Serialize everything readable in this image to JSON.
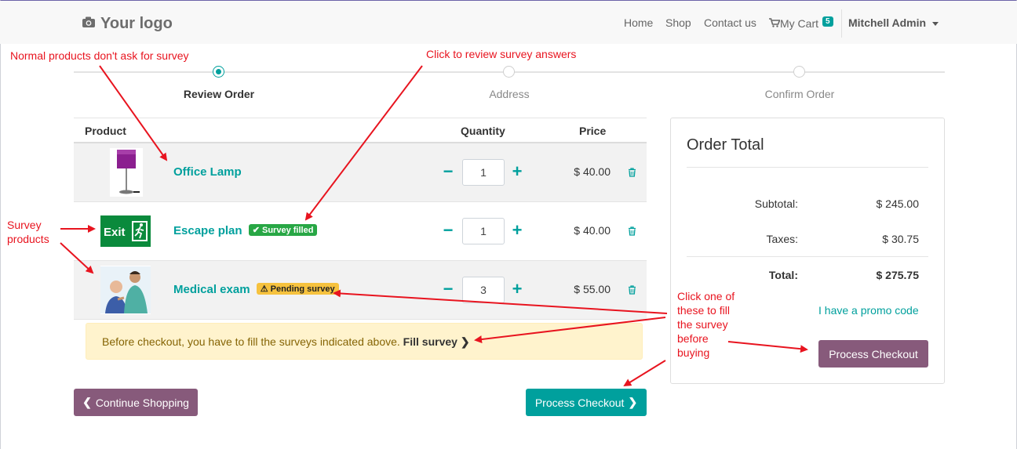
{
  "navbar": {
    "logo": "Your logo",
    "links": [
      "Home",
      "Shop",
      "Contact us"
    ],
    "cart_label": "My Cart",
    "cart_count": "5",
    "user": "Mitchell Admin"
  },
  "wizard": {
    "steps": [
      "Review Order",
      "Address",
      "Confirm Order"
    ],
    "active": 0
  },
  "table": {
    "headers": {
      "product": "Product",
      "quantity": "Quantity",
      "price": "Price"
    },
    "rows": [
      {
        "name": "Office Lamp",
        "badge": "",
        "qty": "1",
        "price": "$ 40.00"
      },
      {
        "name": "Escape plan",
        "badge": "Survey filled",
        "qty": "1",
        "price": "$ 40.00"
      },
      {
        "name": "Medical exam",
        "badge": "Pending survey",
        "qty": "3",
        "price": "$ 55.00"
      }
    ]
  },
  "alert": {
    "text": "Before checkout, you have to fill the surveys indicated above.",
    "link": "Fill survey"
  },
  "buttons": {
    "continue": "Continue Shopping",
    "checkout": "Process Checkout",
    "checkout_side": "Process Checkout"
  },
  "order_total": {
    "title": "Order Total",
    "subtotal_label": "Subtotal:",
    "subtotal": "$ 245.00",
    "taxes_label": "Taxes:",
    "taxes": "$ 30.75",
    "total_label": "Total:",
    "total": "$ 275.75",
    "promo": "I have a promo code"
  },
  "annotations": {
    "normal_products": "Normal products don't ask for survey",
    "review_answers": "Click to review survey answers",
    "survey_products_1": "Survey",
    "survey_products_2": "products",
    "click_one_1": "Click one of",
    "click_one_2": "these to fill",
    "click_one_3": "the survey",
    "click_one_4": "before",
    "click_one_5": "buying"
  },
  "colors": {
    "primary": "#00a09d",
    "secondary": "#875a7b",
    "annotation": "#e8141f"
  }
}
